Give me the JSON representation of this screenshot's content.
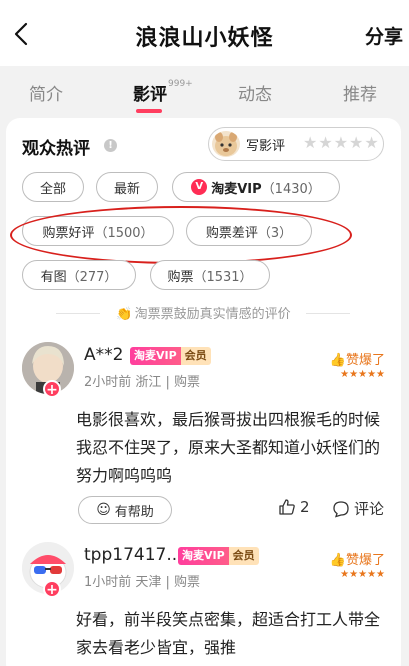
{
  "header": {
    "title": "浪浪山小妖怪",
    "share_label": "分享",
    "back_icon": "chevron-left-icon"
  },
  "tabs": [
    {
      "label": "简介",
      "active": false
    },
    {
      "label": "影评",
      "badge": "999+",
      "active": true
    },
    {
      "label": "动态",
      "active": false
    },
    {
      "label": "推荐",
      "active": false
    }
  ],
  "section": {
    "title": "观众热评",
    "write_review_label": "写影评",
    "stars_glyph": "★★★★★"
  },
  "filters": {
    "all": "全部",
    "newest": "最新",
    "vip_label": "淘麦VIP",
    "vip_count": "（1430）",
    "good_label": "购票好评",
    "good_count": "（1500）",
    "bad_label": "购票差评",
    "bad_count": "（3）",
    "pics_label": "有图",
    "pics_count": "（277）",
    "bought_label": "购票",
    "bought_count": "（1531）"
  },
  "encourage_text": "淘票票鼓励真实情感的评价",
  "reviews": [
    {
      "user": "A**2",
      "vip_badge": "淘麦VIP",
      "member_badge": "会员",
      "meta": "2小时前 浙江 | 购票",
      "rating_label": "赞爆了",
      "stars": "★★★★★",
      "text": "电影很喜欢，最后猴哥拔出四根猴毛的时候我忍不住哭了，原来大圣都知道小妖怪们的努力啊呜呜呜",
      "helpful_label": "有帮助",
      "likes": "2",
      "comment_label": "评论"
    },
    {
      "user": "tpp17417...",
      "vip_badge": "淘麦VIP",
      "member_badge": "会员",
      "meta": "1小时前 天津 | 购票",
      "rating_label": "赞爆了",
      "stars": "★★★★★",
      "text": "好看，前半段笑点密集，超适合打工人带全家去看老少皆宜，强推"
    }
  ],
  "colors": {
    "accent": "#ff3e5f",
    "highlight_oval": "#d8201c",
    "rating": "#e8761c"
  }
}
